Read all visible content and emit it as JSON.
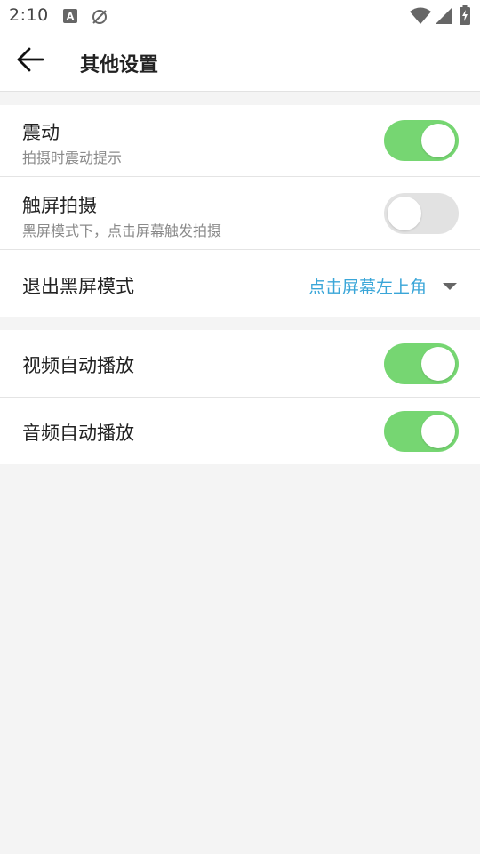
{
  "status_bar": {
    "time": "2:10",
    "icons": [
      "a-notification-icon",
      "sync-off-icon",
      "wifi-icon",
      "signal-icon",
      "battery-icon"
    ]
  },
  "header": {
    "title": "其他设置",
    "back_icon": "arrow-left-icon"
  },
  "settings": {
    "group1": {
      "vibration": {
        "title": "震动",
        "subtitle": "拍摄时震动提示",
        "enabled": true
      },
      "touch_capture": {
        "title": "触屏拍摄",
        "subtitle": "黑屏模式下，点击屏幕触发拍摄",
        "enabled": false
      },
      "exit_black_screen": {
        "title": "退出黑屏模式",
        "value": "点击屏幕左上角"
      }
    },
    "group2": {
      "video_autoplay": {
        "title": "视频自动播放",
        "enabled": true
      },
      "audio_autoplay": {
        "title": "音频自动播放",
        "enabled": true
      }
    }
  },
  "colors": {
    "toggle_on": "#76d672",
    "toggle_off": "#e2e2e2",
    "accent": "#3aa6d8",
    "background": "#f4f4f4"
  }
}
